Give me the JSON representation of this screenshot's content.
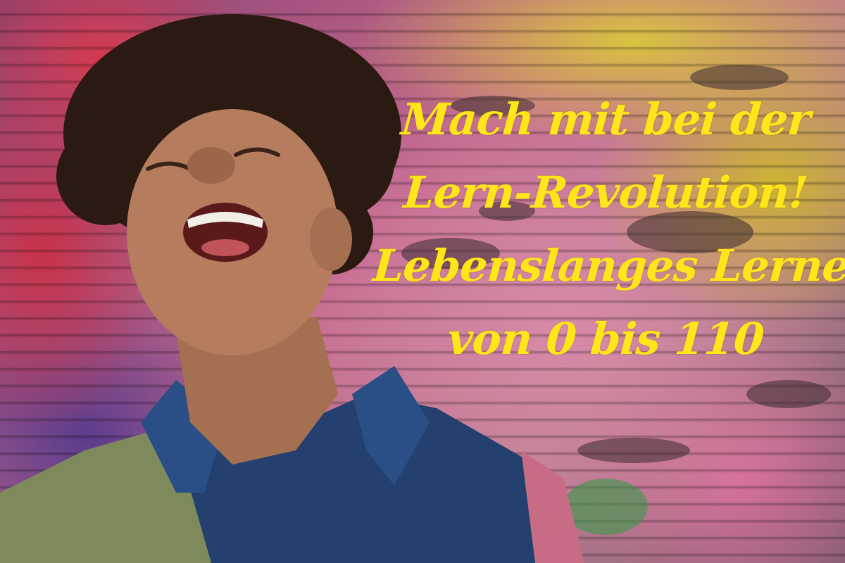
{
  "headline": {
    "line1": "Mach mit bei der",
    "line2": "Lern-Revolution!",
    "line3": "Lebenslanges Lernen",
    "line4": "von 0 bis 110"
  },
  "colors": {
    "headline_text": "#ffe61a",
    "shirt_blue": "#23406e",
    "shirt_olive": "#7e8a5c",
    "shirt_pink": "#c86c86",
    "skin": "#b57d5e",
    "hair": "#2a1a12"
  }
}
